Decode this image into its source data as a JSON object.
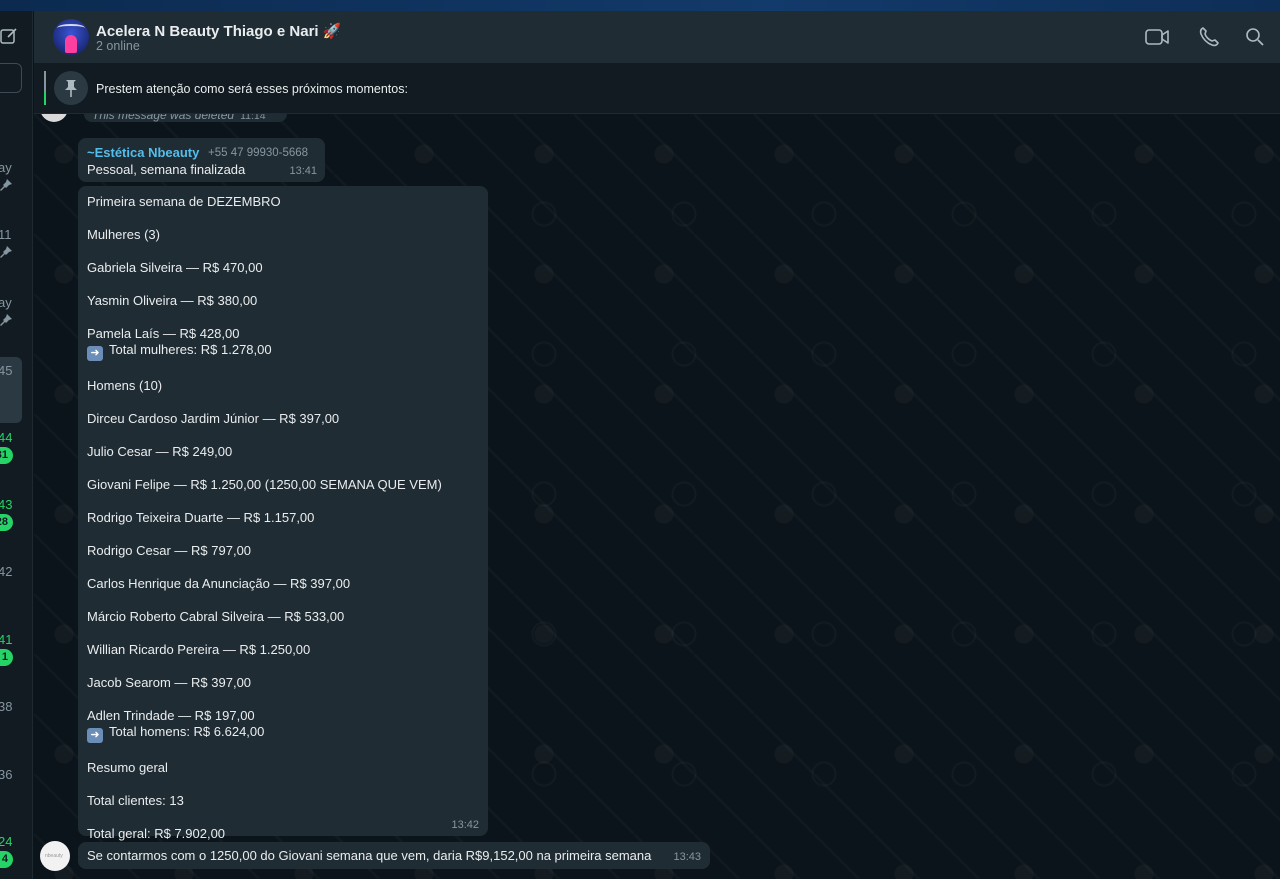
{
  "header": {
    "title": "Acelera N Beauty Thiago e Nari 🚀",
    "subtitle": "2 online"
  },
  "pinned": {
    "text": "Prestem atenção como será esses próximos momentos:"
  },
  "sidebar": {
    "items": [
      {
        "time": "ay",
        "pinned": true,
        "badge": ""
      },
      {
        "time": "11",
        "pinned": true,
        "badge": ""
      },
      {
        "time": "ay",
        "pinned": true,
        "badge": ""
      },
      {
        "time": "45",
        "pinned": false,
        "badge": ""
      },
      {
        "time": "44",
        "pinned": false,
        "badge": "31",
        "green": true
      },
      {
        "time": "43",
        "pinned": false,
        "badge": "28",
        "green": true
      },
      {
        "time": "42",
        "pinned": false,
        "badge": ""
      },
      {
        "time": "41",
        "pinned": false,
        "badge": "1",
        "green": true
      },
      {
        "time": "38",
        "pinned": false,
        "badge": ""
      },
      {
        "time": "36",
        "pinned": false,
        "badge": ""
      },
      {
        "time": "24",
        "pinned": false,
        "badge": "4",
        "green": true
      }
    ]
  },
  "messages": {
    "deleted": {
      "text": "This message was deleted",
      "time": "11:14"
    },
    "m1": {
      "sender": "~Estética Nbeauty",
      "phone": "+55 47 99930-5668",
      "text": "Pessoal, semana finalizada",
      "time": "13:41"
    },
    "m2": {
      "lines": [
        "Primeira semana de DEZEMBRO",
        "",
        "Mulheres (3)",
        "",
        "Gabriela Silveira — R$ 470,00",
        "",
        "Yasmin Oliveira — R$ 380,00",
        "",
        "Pamela Laís — R$ 428,00",
        "➡️ Total mulheres: R$ 1.278,00",
        "",
        "Homens (10)",
        "",
        "Dirceu Cardoso Jardim Júnior — R$ 397,00",
        "",
        "Julio Cesar — R$ 249,00",
        "",
        "Giovani Felipe — R$ 1.250,00 (1250,00 SEMANA QUE VEM)",
        "",
        "Rodrigo Teixeira Duarte — R$ 1.157,00",
        "",
        "Rodrigo Cesar — R$ 797,00",
        "",
        "Carlos Henrique da Anunciação — R$ 397,00",
        "",
        "Márcio Roberto Cabral Silveira — R$ 533,00",
        "",
        "Willian Ricardo Pereira — R$ 1.250,00",
        "",
        "Jacob Searom — R$ 397,00",
        "",
        "Adlen Trindade — R$ 197,00",
        "➡️ Total homens: R$ 6.624,00",
        "",
        "Resumo geral",
        "",
        "Total clientes: 13",
        "",
        "Total geral: R$ 7.902,00"
      ],
      "time": "13:42"
    },
    "m3": {
      "text": "Se contarmos com o 1250,00 do Giovani semana que vem, daria R$9,152,00 na primeira semana",
      "time": "13:43"
    }
  },
  "colors": {
    "accent": "#25d366",
    "sender": "#53bdeb",
    "bubble": "#202c33",
    "background": "#0b141a"
  },
  "icons": [
    "compose-icon",
    "video-call-icon",
    "phone-icon",
    "search-icon",
    "pin-icon"
  ]
}
